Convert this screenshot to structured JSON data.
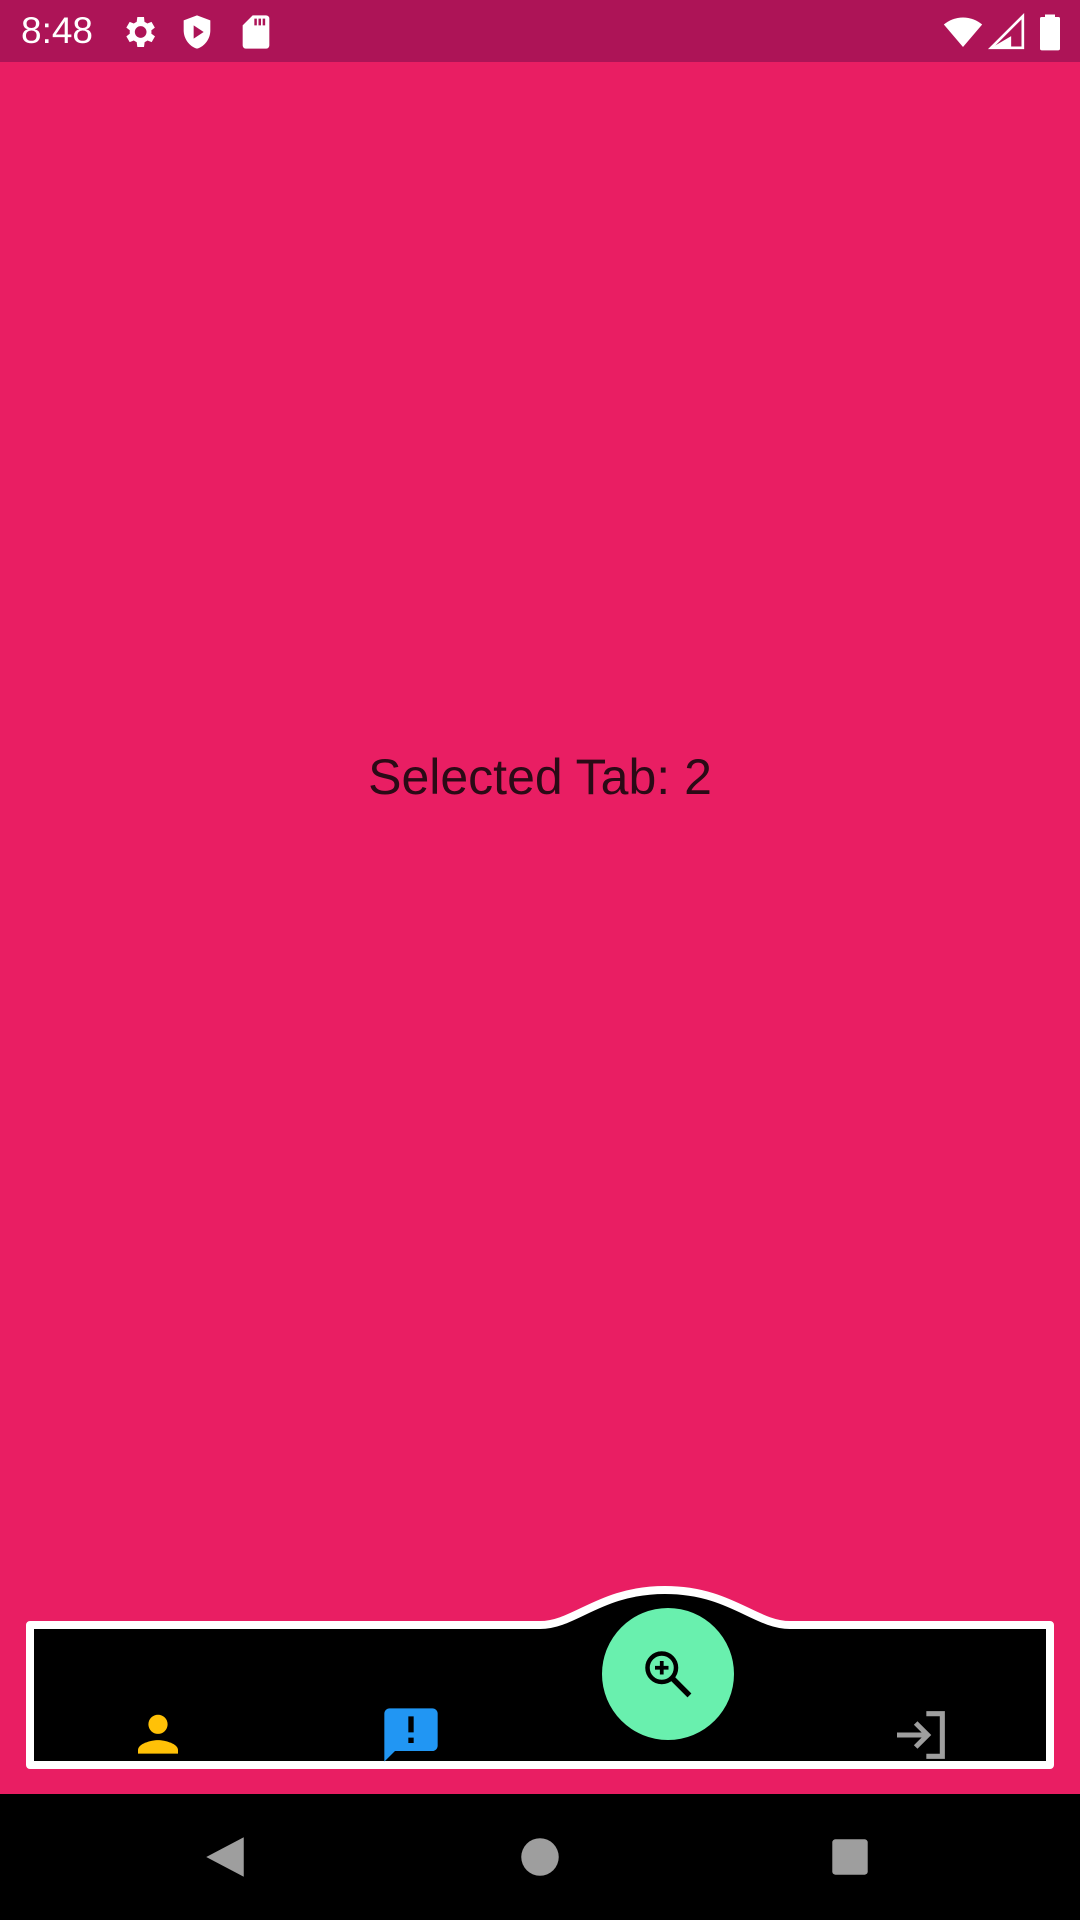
{
  "status_bar": {
    "time": "8:48",
    "icons": [
      "settings-icon",
      "shield-play-icon",
      "sd-card-icon",
      "wifi-icon",
      "cellular-signal-icon",
      "battery-icon"
    ]
  },
  "main": {
    "selected_tab_text": "Selected Tab: 2",
    "background_color": "#E91E63"
  },
  "bottom_nav": {
    "items": [
      {
        "name": "person-icon",
        "color": "#FFC107"
      },
      {
        "name": "feedback-icon",
        "color": "#2196F3"
      },
      {
        "name": "zoom-in-icon",
        "color": "#69F0AE"
      },
      {
        "name": "login-icon",
        "color": "#9E9E9E"
      }
    ]
  },
  "system_nav": {
    "buttons": [
      "back-icon",
      "home-icon",
      "recents-icon"
    ]
  }
}
